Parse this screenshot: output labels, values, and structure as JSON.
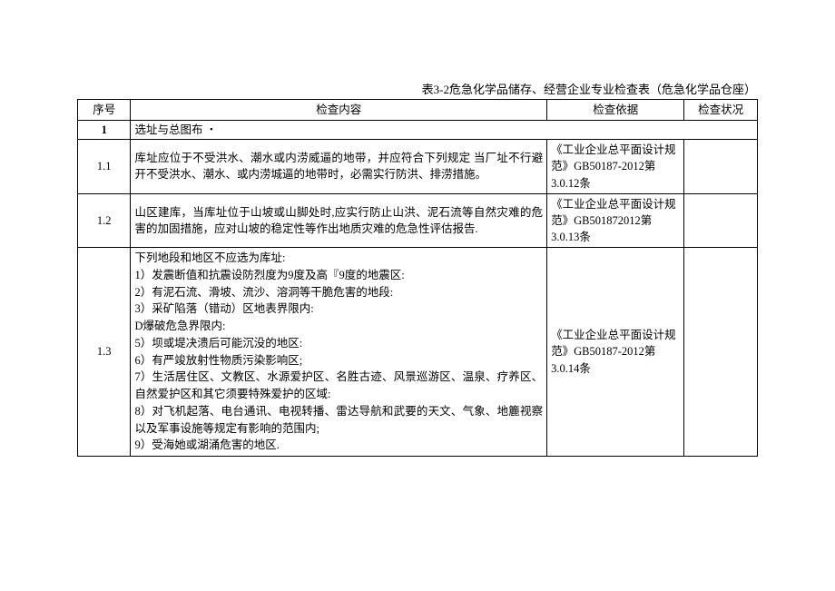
{
  "title": "表3-2危急化学品储存、经营企业专业检查表（危急化学品仓座）",
  "headers": {
    "num": "序号",
    "content": "检查内容",
    "basis": "检查依据",
    "status": "检查状况"
  },
  "section1": {
    "num": "1",
    "label": "选址与总图布 ・"
  },
  "row11": {
    "num": "1.1",
    "content": "库址应位于不受洪水、潮水或内涝威逼的地带，并应符合下列规定 当厂址不行避开不受洪水、潮水、或内涝城逼的地带时，必需实行防洪、排涝措施。",
    "basis": "《工业企业总平面设计规范》GB50187-2012第3.0.12条"
  },
  "row12": {
    "num": "1.2",
    "content": "山区建库，当库址位于山坡或山脚处时,应实行防止山洪、泥石流等自然灾难的危害的加固措施，应对山坡的稳定性等作出地质灾难的危急性评估报告.",
    "basis": "《工业企业总平面设计规范》GB501872012第3.0.13条"
  },
  "row13": {
    "num": "1.3",
    "content": "下列地段和地区不应选为库址:\n1）发震断值和抗震设防烈度为9度及高『9度的地震区:\n2）有泥石流、滑坡、流沙、溶洞等干脆危害的地段:\n3）采矿陷落（错动）区地表界限内:\nD爆破危急界限内:\n5）坝或堤决溃后可能沉没的地区:\n6）有严竣放射性物质污染影响区;\n7）生活居住区、文教区、水源爱护区、名胜古迹、风景巡游区、温泉、疗养区、自然爱护区和其它须要特殊爱护的区域:\n8）对飞机起落、电台通讯、电视转播、雷达导航和武要的天文、气象、地簏视察以及军事设施等规定有影响的范围内;\n9）受海她或湖涌危害的地区.",
    "basis": "《工业企业总平面设计规范》GB50187-2012第3.0.14条"
  }
}
